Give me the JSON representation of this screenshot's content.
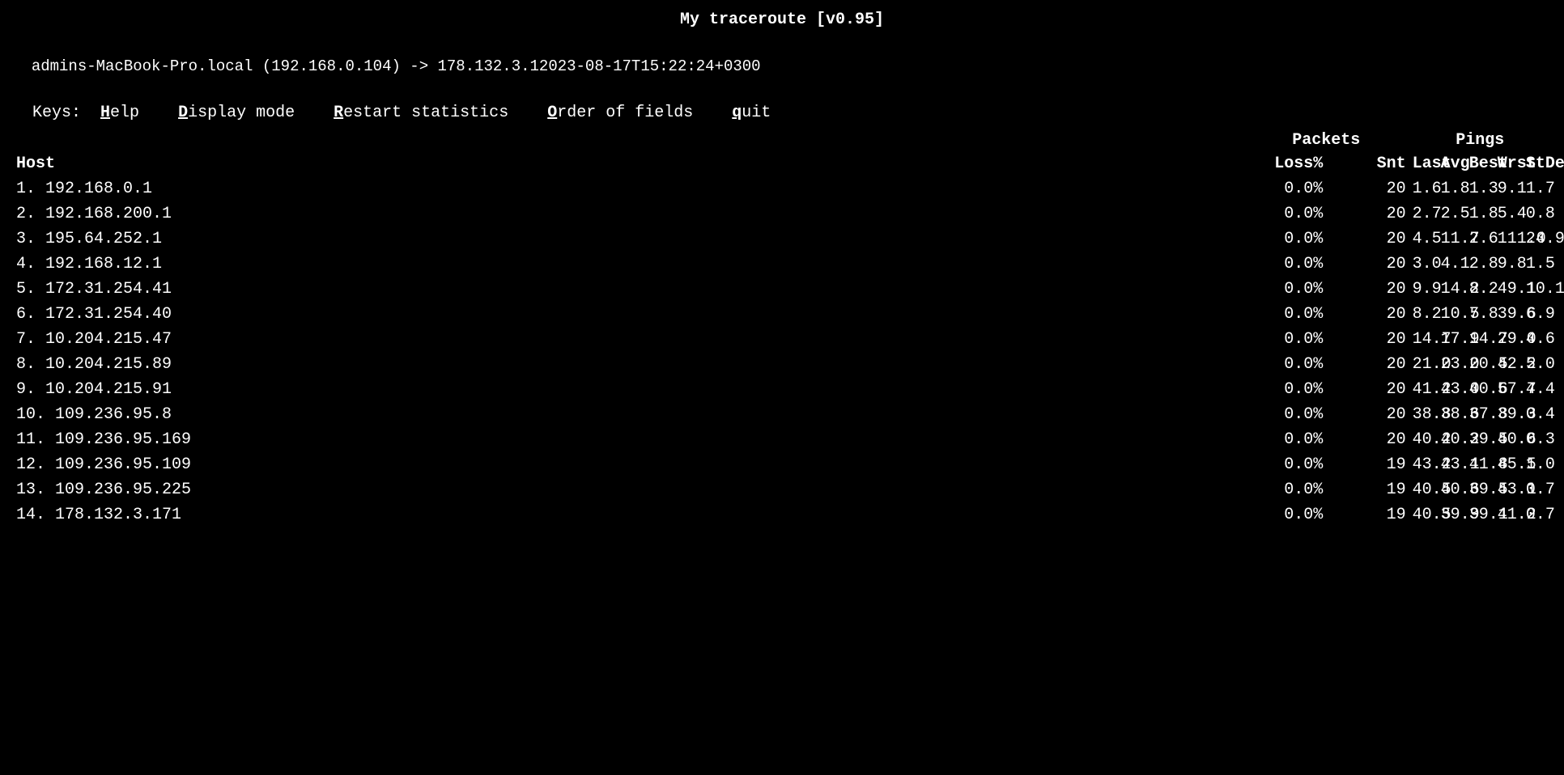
{
  "title": "My traceroute  [v0.95]",
  "source_line": "admins-MacBook-Pro.local (192.168.0.104) -> 178.132.3.12023-08-17T15:22:24+0300",
  "keys_line": {
    "prefix": "Keys: ",
    "items": [
      {
        "key": "H",
        "rest": "elp"
      },
      {
        "spacer": "   "
      },
      {
        "key": "D",
        "rest": "isplay mode"
      },
      {
        "spacer": "   "
      },
      {
        "key": "R",
        "rest": "estart statistics"
      },
      {
        "spacer": "   "
      },
      {
        "key": "O",
        "rest": "rder of fields"
      },
      {
        "spacer": "   "
      },
      {
        "key": "q",
        "rest": "uit"
      }
    ]
  },
  "table": {
    "group_headers": {
      "packets": "Packets",
      "pings": "Pings"
    },
    "column_headers": {
      "host": "Host",
      "loss": "Loss%",
      "snt": "Snt",
      "last": "Last",
      "avg": "Avg",
      "best": "Best",
      "wrst": "Wrst",
      "stdev": "StDev"
    },
    "rows": [
      {
        "num": "1.",
        "host": "192.168.0.1",
        "loss": "0.0%",
        "snt": "20",
        "last": "1.6",
        "avg": "1.8",
        "best": "1.3",
        "wrst": "9.1",
        "stdev": "1.7"
      },
      {
        "num": "2.",
        "host": "192.168.200.1",
        "loss": "0.0%",
        "snt": "20",
        "last": "2.7",
        "avg": "2.5",
        "best": "1.8",
        "wrst": "5.4",
        "stdev": "0.8"
      },
      {
        "num": "3.",
        "host": "195.64.252.1",
        "loss": "0.0%",
        "snt": "20",
        "last": "4.5",
        "avg": "11.7",
        "best": "2.6",
        "wrst": "111.0",
        "stdev": "24.9"
      },
      {
        "num": "4.",
        "host": "192.168.12.1",
        "loss": "0.0%",
        "snt": "20",
        "last": "3.0",
        "avg": "4.1",
        "best": "2.8",
        "wrst": "9.8",
        "stdev": "1.5"
      },
      {
        "num": "5.",
        "host": "172.31.254.41",
        "loss": "0.0%",
        "snt": "20",
        "last": "9.9",
        "avg": "14.2",
        "best": "8.2",
        "wrst": "49.1",
        "stdev": "10.1"
      },
      {
        "num": "6.",
        "host": "172.31.254.40",
        "loss": "0.0%",
        "snt": "20",
        "last": "8.2",
        "avg": "10.5",
        "best": "7.8",
        "wrst": "39.6",
        "stdev": "6.9"
      },
      {
        "num": "7.",
        "host": "10.204.215.47",
        "loss": "0.0%",
        "snt": "20",
        "last": "14.7",
        "avg": "17.9",
        "best": "14.7",
        "wrst": "29.0",
        "stdev": "4.6"
      },
      {
        "num": "8.",
        "host": "10.204.215.89",
        "loss": "0.0%",
        "snt": "20",
        "last": "21.0",
        "avg": "23.0",
        "best": "20.5",
        "wrst": "42.2",
        "stdev": "5.0"
      },
      {
        "num": "9.",
        "host": "10.204.215.91",
        "loss": "0.0%",
        "snt": "20",
        "last": "41.2",
        "avg": "43.0",
        "best": "40.6",
        "wrst": "57.7",
        "stdev": "4.4"
      },
      {
        "num": "10.",
        "host": "109.236.95.8",
        "loss": "0.0%",
        "snt": "20",
        "last": "38.8",
        "avg": "38.6",
        "best": "37.8",
        "wrst": "39.3",
        "stdev": "0.4"
      },
      {
        "num": "11.",
        "host": "109.236.95.169",
        "loss": "0.0%",
        "snt": "20",
        "last": "40.2",
        "avg": "40.2",
        "best": "39.5",
        "wrst": "40.6",
        "stdev": "0.3"
      },
      {
        "num": "12.",
        "host": "109.236.95.109",
        "loss": "0.0%",
        "snt": "19",
        "last": "43.2",
        "avg": "43.1",
        "best": "41.8",
        "wrst": "45.5",
        "stdev": "1.0"
      },
      {
        "num": "13.",
        "host": "109.236.95.225",
        "loss": "0.0%",
        "snt": "19",
        "last": "40.5",
        "avg": "40.6",
        "best": "39.5",
        "wrst": "43.1",
        "stdev": "0.7"
      },
      {
        "num": "14.",
        "host": "178.132.3.171",
        "loss": "0.0%",
        "snt": "19",
        "last": "40.5",
        "avg": "39.9",
        "best": "39.1",
        "wrst": "41.2",
        "stdev": "0.7"
      }
    ]
  }
}
